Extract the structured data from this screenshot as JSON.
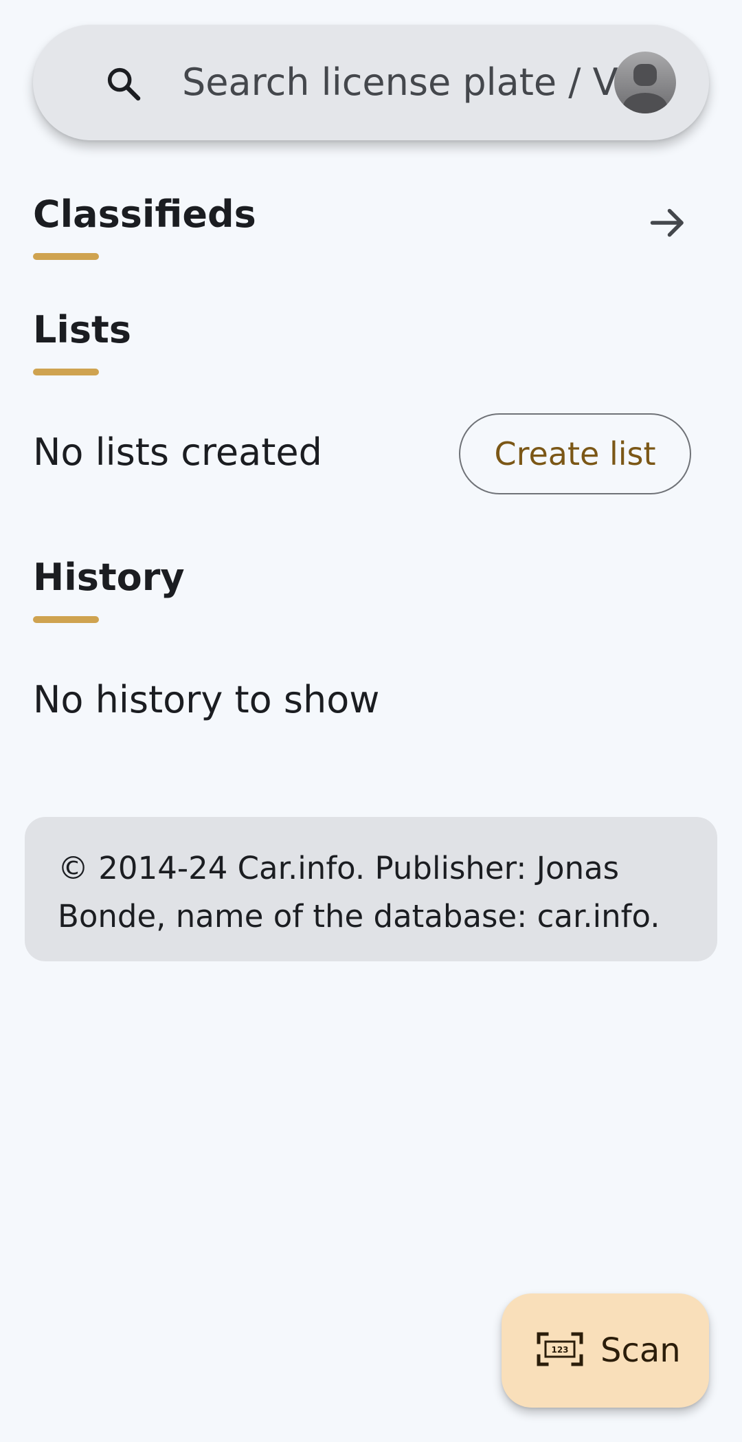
{
  "search": {
    "placeholder": "Search license plate / VIN",
    "icon": "search-icon"
  },
  "avatar": {
    "icon": "account-avatar"
  },
  "sections": {
    "classifieds": {
      "title": "Classifieds",
      "action_icon": "arrow-right-icon"
    },
    "lists": {
      "title": "Lists",
      "empty_text": "No lists created",
      "create_button": "Create list"
    },
    "history": {
      "title": "History",
      "empty_text": "No history to show"
    }
  },
  "footer": {
    "line1": "© 2014-24 Car.info. Publisher: Jonas",
    "line2": "Bonde, name of the database: car.info."
  },
  "fab": {
    "label": "Scan",
    "icon": "scan-plate-icon",
    "icon_text": "123"
  },
  "colors": {
    "background": "#f5f8fc",
    "accent_underline": "#cfa350",
    "fab_background": "#f9dfba",
    "button_text": "#7b5716"
  }
}
